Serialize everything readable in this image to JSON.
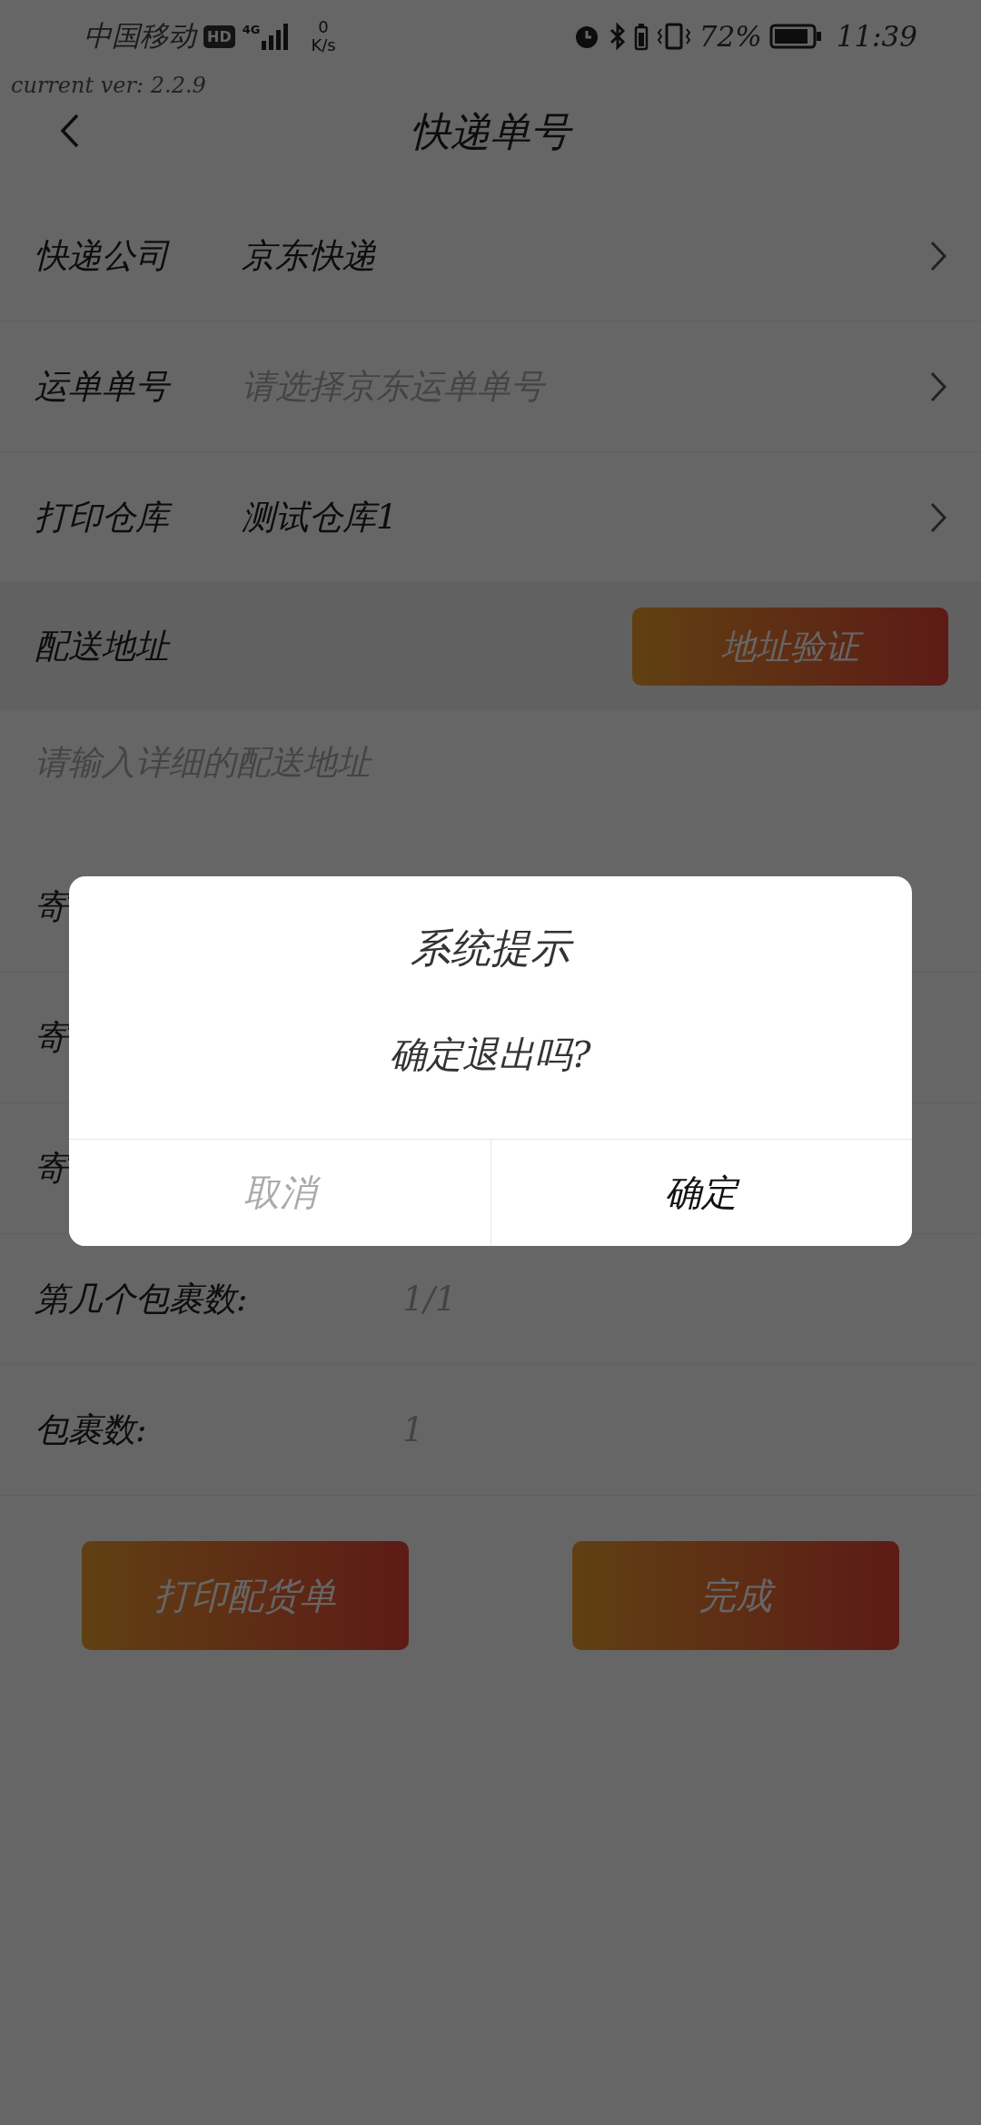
{
  "status_bar": {
    "carrier": "中国移动",
    "network_badge": "HD",
    "net_type": "4G",
    "speed_value": "0",
    "speed_unit": "K/s",
    "battery_percent": "72%",
    "time": "11:39"
  },
  "version_label": "current ver: 2.2.9",
  "header": {
    "title": "快递单号"
  },
  "select_rows": [
    {
      "label": "快递公司",
      "kind": "value",
      "text": "京东快递"
    },
    {
      "label": "运单单号",
      "kind": "placeholder",
      "text": "请选择京东运单单号"
    },
    {
      "label": "打印仓库",
      "kind": "value",
      "text": "测试仓库1"
    }
  ],
  "address": {
    "label": "配送地址",
    "button": "地址验证",
    "placeholder": "请输入详细的配送地址"
  },
  "info_rows": [
    {
      "label": "寄"
    },
    {
      "label": "寄"
    },
    {
      "label": "寄"
    },
    {
      "label": "第几个包裹数:",
      "value": "1/1"
    },
    {
      "label": "包裹数:",
      "value": "1"
    }
  ],
  "buttons": [
    "打印配货单",
    "完成"
  ],
  "dialog": {
    "title": "系统提示",
    "message": "确定退出吗?",
    "buttons": [
      {
        "label": "取消",
        "kind": "cancel"
      },
      {
        "label": "确定",
        "kind": "confirm"
      }
    ]
  }
}
